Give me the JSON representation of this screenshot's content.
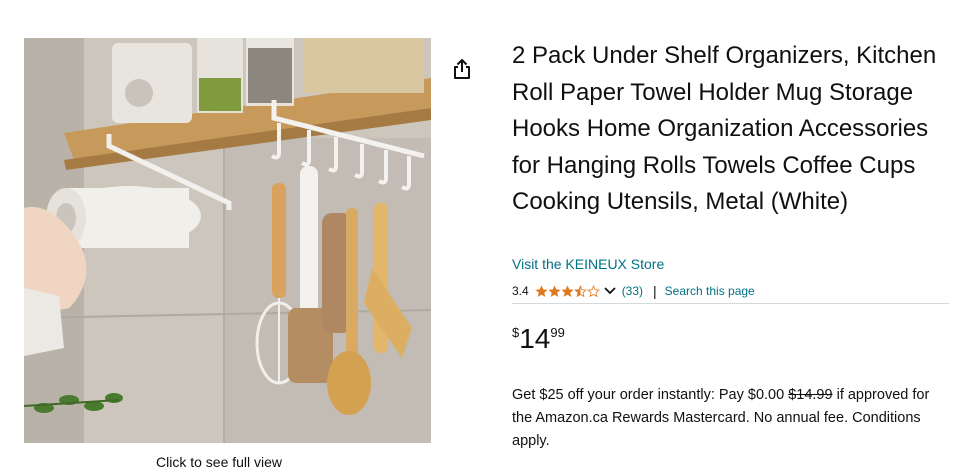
{
  "product": {
    "title": "2 Pack Under Shelf Organizers, Kitchen Roll Paper Towel Holder Mug Storage Hooks Home Organization Accessories for Hanging Rolls Towels Coffee Cups Cooking Utensils, Metal (White)",
    "store_link": "Visit the KEINEUX Store",
    "rating": {
      "value": "3.4",
      "stars_filled": 3.4,
      "stars_total": 5,
      "review_count": "(33)",
      "separator": "|",
      "search_link": "Search this page"
    },
    "price": {
      "symbol": "$",
      "whole": "14",
      "fraction": "99"
    },
    "promo": {
      "prefix": "Get $25 off your order instantly: Pay $0.00 ",
      "strike_price": "$14.99",
      "suffix": " if approved for the Amazon.ca Rewards Mastercard. No annual fee. Conditions apply."
    },
    "image_caption": "Click to see full view"
  },
  "icons": {
    "share": "share-icon",
    "star": "star-icon",
    "chevron": "chevron-down-icon"
  },
  "colors": {
    "link": "#007185",
    "star": "#DE7921",
    "text": "#0F1111",
    "divider": "#D5D9D9"
  }
}
